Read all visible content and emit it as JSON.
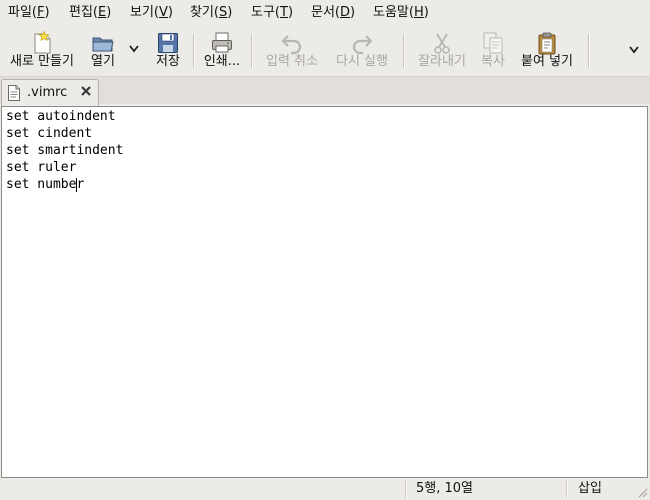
{
  "menubar": {
    "items": [
      {
        "label": "파일",
        "mnemonic": "F"
      },
      {
        "label": "편집",
        "mnemonic": "E"
      },
      {
        "label": "보기",
        "mnemonic": "V"
      },
      {
        "label": "찾기",
        "mnemonic": "S"
      },
      {
        "label": "도구",
        "mnemonic": "T"
      },
      {
        "label": "문서",
        "mnemonic": "D"
      },
      {
        "label": "도움말",
        "mnemonic": "H"
      }
    ]
  },
  "toolbar": {
    "new_label": "새로 만들기",
    "open_label": "열기",
    "save_label": "저장",
    "print_label": "인쇄...",
    "undo_label": "입력 취소",
    "redo_label": "다시 실행",
    "cut_label": "잘라내기",
    "copy_label": "복사",
    "paste_label": "붙여 넣기"
  },
  "tabs": [
    {
      "title": ".vimrc"
    }
  ],
  "editor": {
    "lines": [
      "set autoindent",
      "set cindent",
      "set smartindent",
      "set ruler",
      "set number"
    ],
    "cursor": {
      "line": 5,
      "column": 10
    }
  },
  "statusbar": {
    "position": "5행, 10열",
    "mode": "삽입"
  },
  "colors": {
    "window_bg": "#edebe8",
    "editor_bg": "#ffffff",
    "disabled_text": "#a8a6a2"
  }
}
